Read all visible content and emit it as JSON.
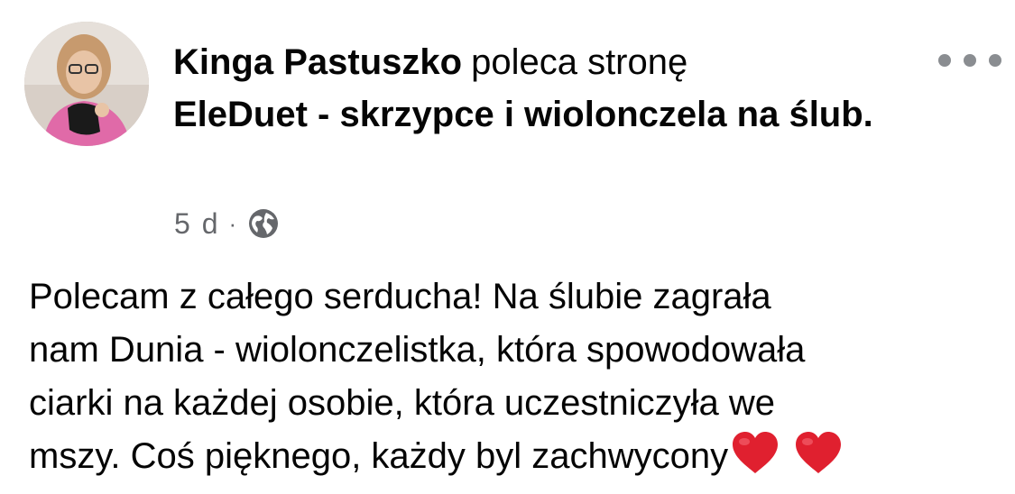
{
  "post": {
    "author": "Kinga Pastuszko",
    "verb": "poleca stronę",
    "page_name": "EleDuet - skrzypce i wiolonczela na ślub.",
    "time": "5 d",
    "separator": "·",
    "privacy_icon": "globe-icon",
    "more_icon": "more-options-icon",
    "body_lines": [
      "Polecam z całego serducha! Na ślubie zagrała",
      "nam Dunia - wiolonczelistka, która spowodowała",
      "ciarki na każdej osobie, która uczestniczyła we",
      "mszy. Coś pięknego, każdy byl zachwycony"
    ],
    "emoji": [
      "red-heart",
      "red-heart"
    ]
  },
  "colors": {
    "text": "#050505",
    "secondary_text": "#65676b",
    "heart": "#e0202f"
  }
}
